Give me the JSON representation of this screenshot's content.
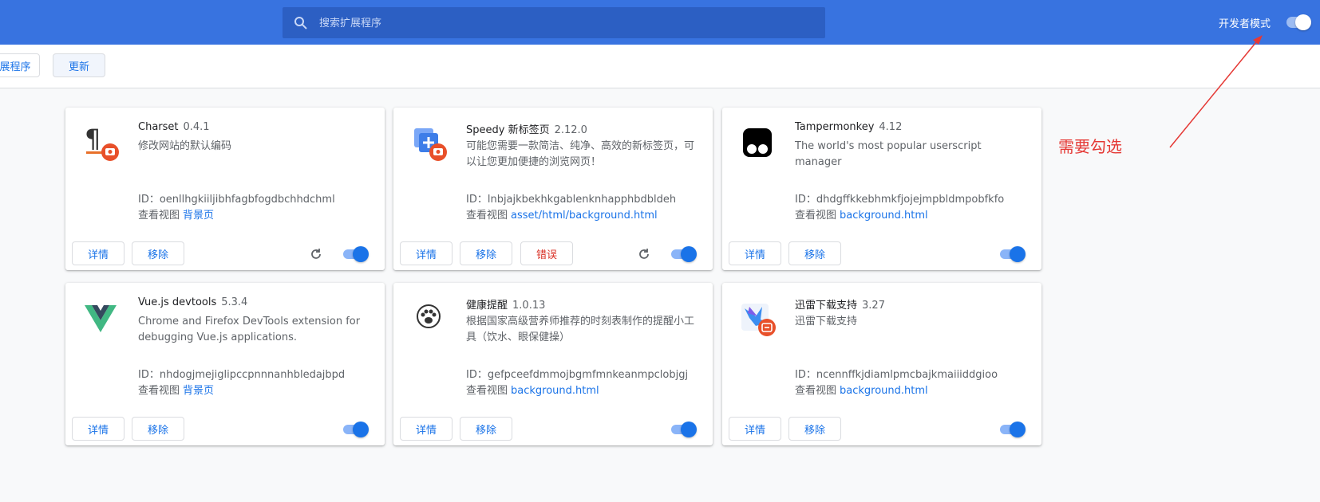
{
  "search": {
    "placeholder": "搜索扩展程序"
  },
  "header": {
    "devmode_label": "开发者模式",
    "devmode_on": true
  },
  "toolbar": {
    "pack_label": "展程序",
    "update_label": "更新"
  },
  "labels": {
    "details": "详情",
    "remove": "移除",
    "errors": "错误",
    "inspect_views": "查看视图"
  },
  "extensions": [
    {
      "name": "Charset",
      "version": "0.4.1",
      "description": "修改网站的默认编码",
      "id": "ID：oenllhgkiiljibhfagbfogdbchhdchml",
      "view_link": "背景页",
      "icon": "pilcrow-icon",
      "has_error": false,
      "has_reload": true,
      "enabled": true
    },
    {
      "name": "Speedy 新标签页",
      "version": "2.12.0",
      "description": "可能您需要一款简洁、纯净、高效的新标签页，可以让您更加便捷的浏览网页！",
      "id": "ID：lnbjajkbekhkgablenknhapphbdbldeh",
      "view_link": "asset/html/background.html",
      "icon": "new-tab-icon",
      "has_error": true,
      "has_reload": true,
      "enabled": true
    },
    {
      "name": "Tampermonkey",
      "version": "4.12",
      "description": "The world's most popular userscript manager",
      "id": "ID：dhdgffkkebhmkfjojejmpbldmpobfkfo",
      "view_link": "background.html",
      "icon": "tampermonkey-icon",
      "has_error": false,
      "has_reload": false,
      "enabled": true
    },
    {
      "name": "Vue.js devtools",
      "version": "5.3.4",
      "description": "Chrome and Firefox DevTools extension for debugging Vue.js applications.",
      "id": "ID：nhdogjmejiglipccpnnnanhbledajbpd",
      "view_link": "背景页",
      "icon": "vue-icon",
      "has_error": false,
      "has_reload": false,
      "enabled": true
    },
    {
      "name": "健康提醒",
      "version": "1.0.13",
      "description": "根据国家高级营养师推荐的时刻表制作的提醒小工具（饮水、眼保健操）",
      "id": "ID：gefpceefdmmojbgmfmnkeanmpclobjgj",
      "view_link": "background.html",
      "icon": "paw-icon",
      "has_error": false,
      "has_reload": false,
      "enabled": true
    },
    {
      "name": "迅雷下载支持",
      "version": "3.27",
      "description": "迅雷下载支持",
      "id": "ID：ncennffkjdiamlpmcbajkmaiiiddgioo",
      "view_link": "background.html",
      "icon": "thunder-bird-icon",
      "has_error": false,
      "has_reload": false,
      "enabled": true
    }
  ],
  "annotation": {
    "text": "需要勾选",
    "color": "#e53935"
  },
  "colors": {
    "header": "#3873e0",
    "search": "#2c5fc3",
    "link": "#1a73e8",
    "error": "#d93025"
  }
}
